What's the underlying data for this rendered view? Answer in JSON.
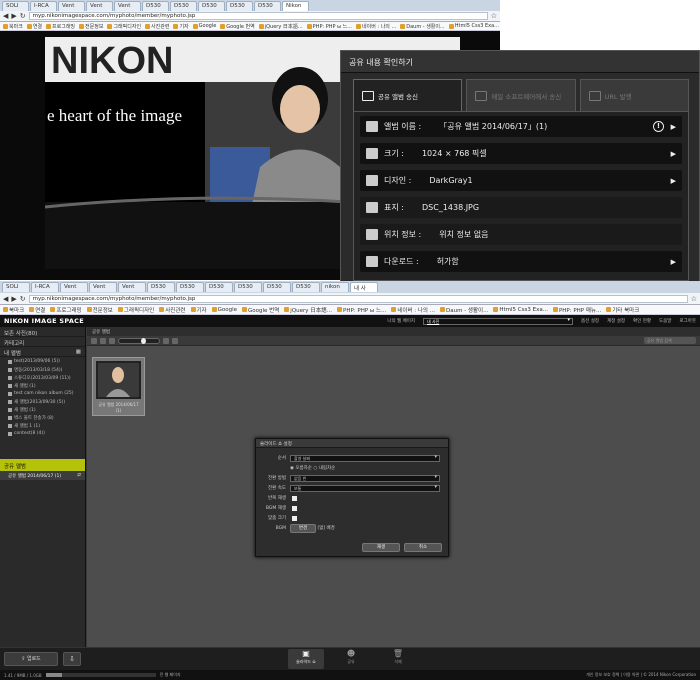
{
  "top_browser": {
    "tabs": [
      "SOLI",
      "I-RCA",
      "Vent",
      "Vent",
      "Vent",
      "D530",
      "D530",
      "D530",
      "D530",
      "D530",
      "Nikon"
    ],
    "url": "myp.nikonimagespace.com/myphoto/member/myphoto.jsp",
    "bookmarks": [
      "북마크",
      "연결",
      "프로그래밍",
      "전문정보",
      "그래픽디자인",
      "사진관련",
      "기자",
      "Google",
      "Google 번역",
      "jQuery 日本語...",
      "PHP: PHP ы 느...",
      "네이버 : 나의 ...",
      "Daum - 생활이...",
      "Html5 Css3 Exa...",
      "PHP: PHP 매뉴...",
      "기타 북마크"
    ]
  },
  "photo": {
    "banner_text": "e heart of the image",
    "brand": "NIKON"
  },
  "share_dialog": {
    "title": "공유 내용 확인하기",
    "tabs": [
      "공유 앨범 송신",
      "메일 소프트웨어에서 송신",
      "URL 발행"
    ],
    "rows": [
      {
        "icon": "album-icon",
        "label": "앨범 이름 :",
        "value": "「공유 앨범 2014/06/17」(1)",
        "warn": true,
        "arrow": true
      },
      {
        "icon": "size-icon",
        "label": "크기 :",
        "value": "1024 × 768 픽셀",
        "warn": false,
        "arrow": true
      },
      {
        "icon": "design-icon",
        "label": "디자인 :",
        "value": "DarkGray1",
        "warn": false,
        "arrow": true
      },
      {
        "icon": "cover-icon",
        "label": "표지 :",
        "value": "DSC_1438.JPG",
        "warn": false,
        "arrow": false
      },
      {
        "icon": "location-icon",
        "label": "위치 정보 :",
        "value": "위치 정보 없음",
        "warn": false,
        "arrow": false
      },
      {
        "icon": "download-icon",
        "label": "다운로드 :",
        "value": "허가함",
        "warn": false,
        "arrow": true
      }
    ]
  },
  "bottom_browser": {
    "tabs": [
      "SOLI",
      "I-RCA",
      "Vent",
      "Vent",
      "Vent",
      "D530",
      "D530",
      "D530",
      "D530",
      "D530",
      "D530",
      "nikon",
      "내 사"
    ],
    "url": "myp.nikonimagespace.com/myphoto/member/myphoto.jsp",
    "bookmarks": [
      "북마크",
      "연결",
      "프로그래밍",
      "전문정보",
      "그래픽디자인",
      "사진관련",
      "기자",
      "Google",
      "Google 번역",
      "jQuery 日本語...",
      "PHP: PHP ы 느...",
      "네이버 : 나의 ...",
      "Daum - 생활이...",
      "Html5 Css3 Exa...",
      "PHP: PHP 매뉴...",
      "기타 북마크"
    ]
  },
  "nis": {
    "logo": "NIKON IMAGE SPACE",
    "nav": [
      "나의 웹 페이지",
      "내 사진",
      "옵션 설정",
      "계정 설정",
      "확인 현황",
      "도움말",
      "로그아웃"
    ],
    "sidebar": {
      "saved": "보존 사진(80)",
      "category": "카테고리",
      "my_album": "내 앨범",
      "albums": [
        "test(2013/09/06 (5))",
        "명동(2013/03/18 (54))",
        "스튜디오(2013/03/09 (11))",
        "새 앨범 (1)",
        "test cam nikon album (25)",
        "새 앨범(2013/09/30 (5))",
        "새 앨범 (1)",
        "벽스 울트 찬송가 (8)",
        "새 앨범 1 (1)",
        "contest(8 (4))"
      ],
      "shared_header": "공유 앨범",
      "shared_item": "공유 앨범 2014/06/17 (1)"
    },
    "main_header": "공유 앨범",
    "search_placeholder": "공유 앨범 검색",
    "thumb_caption": "공유 앨범 2014/06/17 (1)",
    "slideshow": {
      "title": "슬라이드 쇼 설정",
      "rows": [
        {
          "label": "순서",
          "value": "촬영 날짜"
        },
        {
          "label": "전환 방법",
          "value": "없음 빈"
        },
        {
          "label": "전환 속도",
          "value": "보통"
        }
      ],
      "sort": [
        "오름차순",
        "내림차순"
      ],
      "checks": [
        "반복 재생",
        "BGM 재생",
        "맞춤 크기"
      ],
      "bgm_label": "BGM",
      "bgm_button": "변경",
      "bgm_value": "[없] 배경",
      "ok": "재생",
      "cancel": "취소"
    },
    "bottom": {
      "upload": "업로드",
      "items": [
        "슬라이드 쇼",
        "공유",
        "삭제"
      ]
    },
    "status": {
      "left": "1.41 / 9MB / 1.0GB",
      "progress": 0.15,
      "middle": "전 웹 페이지",
      "right": "개인 정보 보호 정책 | 이용 약관 | © 2014 Nikon Corporation"
    }
  }
}
